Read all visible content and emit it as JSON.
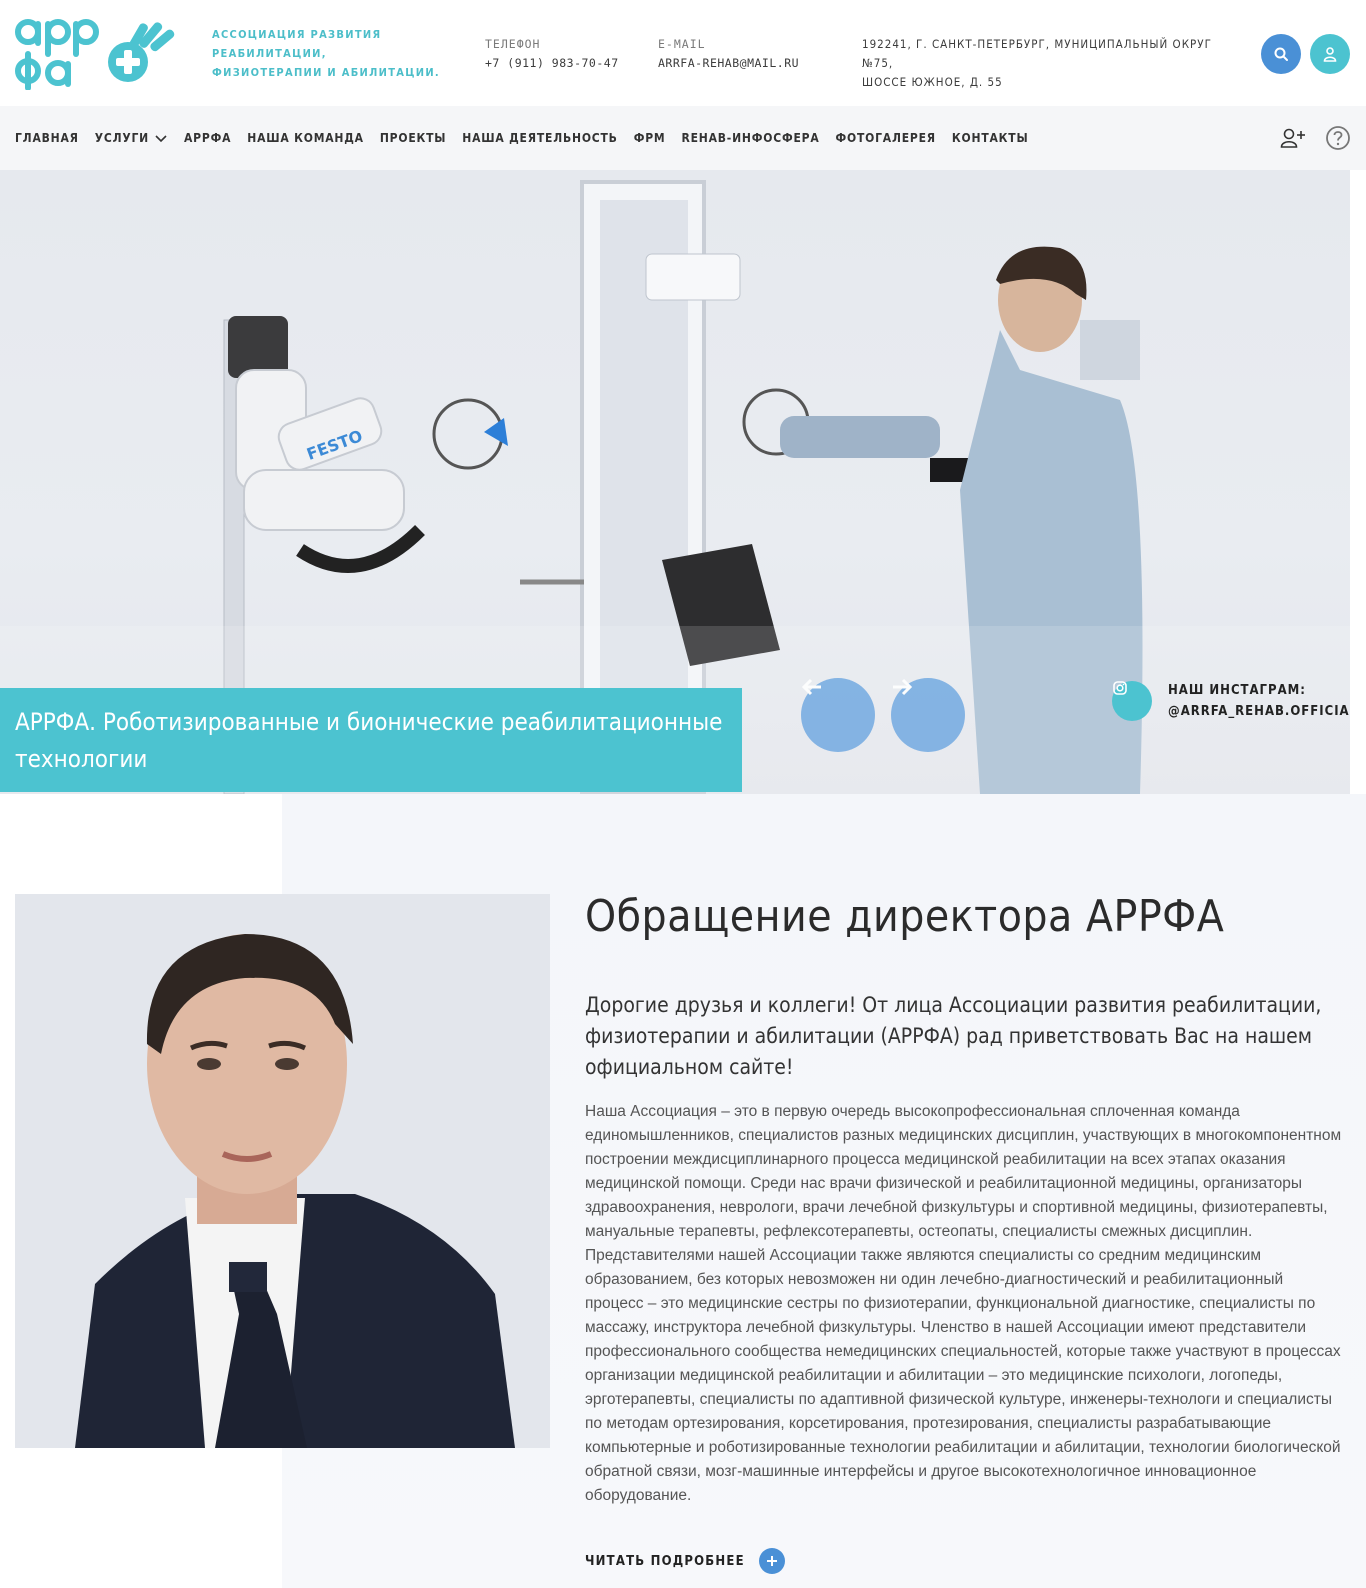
{
  "header": {
    "tagline": "АССОЦИАЦИЯ РАЗВИТИЯ РЕАБИЛИТАЦИИ, ФИЗИОТЕРАПИИ И АБИЛИТАЦИИ.",
    "phone_label": "ТЕЛЕФОН",
    "phone_value": "+7 (911) 983-70-47",
    "email_label": "E-MAIL",
    "email_value": "ARRFA-REHAB@MAIL.RU",
    "address_line1": "192241, Г. САНКТ-ПЕТЕРБУРГ, МУНИЦИПАЛЬНЫЙ ОКРУГ №75,",
    "address_line2": "ШОССЕ ЮЖНОЕ, Д. 55",
    "search_icon": "search-icon",
    "user_icon": "user-icon",
    "logo_text": "арр фа"
  },
  "nav": {
    "items": [
      {
        "label": "ГЛАВНАЯ"
      },
      {
        "label": "УСЛУГИ"
      },
      {
        "label": "АРРФА"
      },
      {
        "label": "НАША КОМАНДА"
      },
      {
        "label": "ПРОЕКТЫ"
      },
      {
        "label": "НАША ДЕЯТЕЛЬНОСТЬ"
      },
      {
        "label": "ФРМ"
      },
      {
        "label": "REHAB-ИНФОСФЕРА"
      },
      {
        "label": "ФОТОГАЛЕРЕЯ"
      },
      {
        "label": "КОНТАКТЫ"
      }
    ],
    "register_icon": "add-user-icon",
    "help_icon": "help-icon"
  },
  "hero": {
    "caption": "АРРФА. Роботизированные и бионические реабилитационные технологии",
    "instagram_line1": "НАШ ИНСТАГРАМ:",
    "instagram_line2": "@ARRFA_REHAB.OFFICIAL",
    "robot_brand": "FESTO"
  },
  "director": {
    "title": "Обращение директора АРРФА",
    "lead": "Дорогие друзья и коллеги! От лица Ассоциации развития реабилитации, физиотерапии и абилитации (АРРФА) рад приветствовать Вас на нашем официальном сайте!",
    "body": "Наша Ассоциация – это в первую очередь высокопрофессиональная сплоченная команда единомышленников, специалистов разных медицинских дисциплин, участвующих в многокомпонентном построении междисциплинарного процесса медицинской реабилитации на всех этапах оказания медицинской помощи. Среди нас врачи физической и реабилитационной медицины, организаторы здравоохранения, неврологи, врачи лечебной физкультуры и спортивной медицины, физиотерапевты, мануальные терапевты, рефлексотерапевты, остеопаты, специалисты смежных дисциплин. Представителями нашей Ассоциации также являются специалисты со средним медицинским образованием, без которых невозможен ни один лечебно-диагностический и реабилитационный процесс – это медицинские сестры по физиотерапии, функциональной диагностике, специалисты по массажу, инструктора лечебной физкультуры. Членство в нашей Ассоциации имеют представители профессионального сообщества немедицинских специальностей, которые также участвуют в процессах организации медицинской реабилитации и абилитации – это медицинские психологи, логопеды, эрготерапевты, специалисты по адаптивной физической культуре, инженеры-технологи и специалисты по методам ортезирования, корсетирования, протезирования, специалисты разрабатывающие компьютерные и роботизированные технологии реабилитации и абилитации, технологии биологической обратной связи, мозг-машинные интерфейсы и другое высокотехнологичное инновационное оборудование.",
    "read_more": "ЧИТАТЬ ПОДРОБНЕЕ"
  },
  "colors": {
    "accent_teal": "#4cc3d0",
    "accent_blue": "#4a90d6",
    "arrow_blue": "#7aaee2"
  }
}
